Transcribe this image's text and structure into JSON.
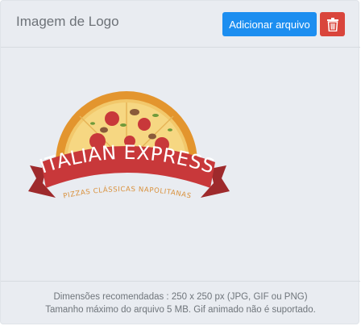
{
  "header": {
    "title": "Imagem de Logo",
    "add_button_label": "Adicionar arquivo",
    "delete_icon": "trash-icon"
  },
  "logo": {
    "brand_name": "ITALIAN EXPRESS",
    "tagline": "PIZZAS CLÁSSICAS NAPOLITANAS"
  },
  "footer": {
    "line1": "Dimensões recomendadas : 250 x 250 px (JPG, GIF ou PNG)",
    "line2": "Tamanho máximo do arquivo 5 MB. Gif animado não é suportado."
  },
  "colors": {
    "accent": "#1c8ef0",
    "danger": "#d9453c",
    "ribbon": "#c8383a",
    "crust": "#e3952e"
  }
}
